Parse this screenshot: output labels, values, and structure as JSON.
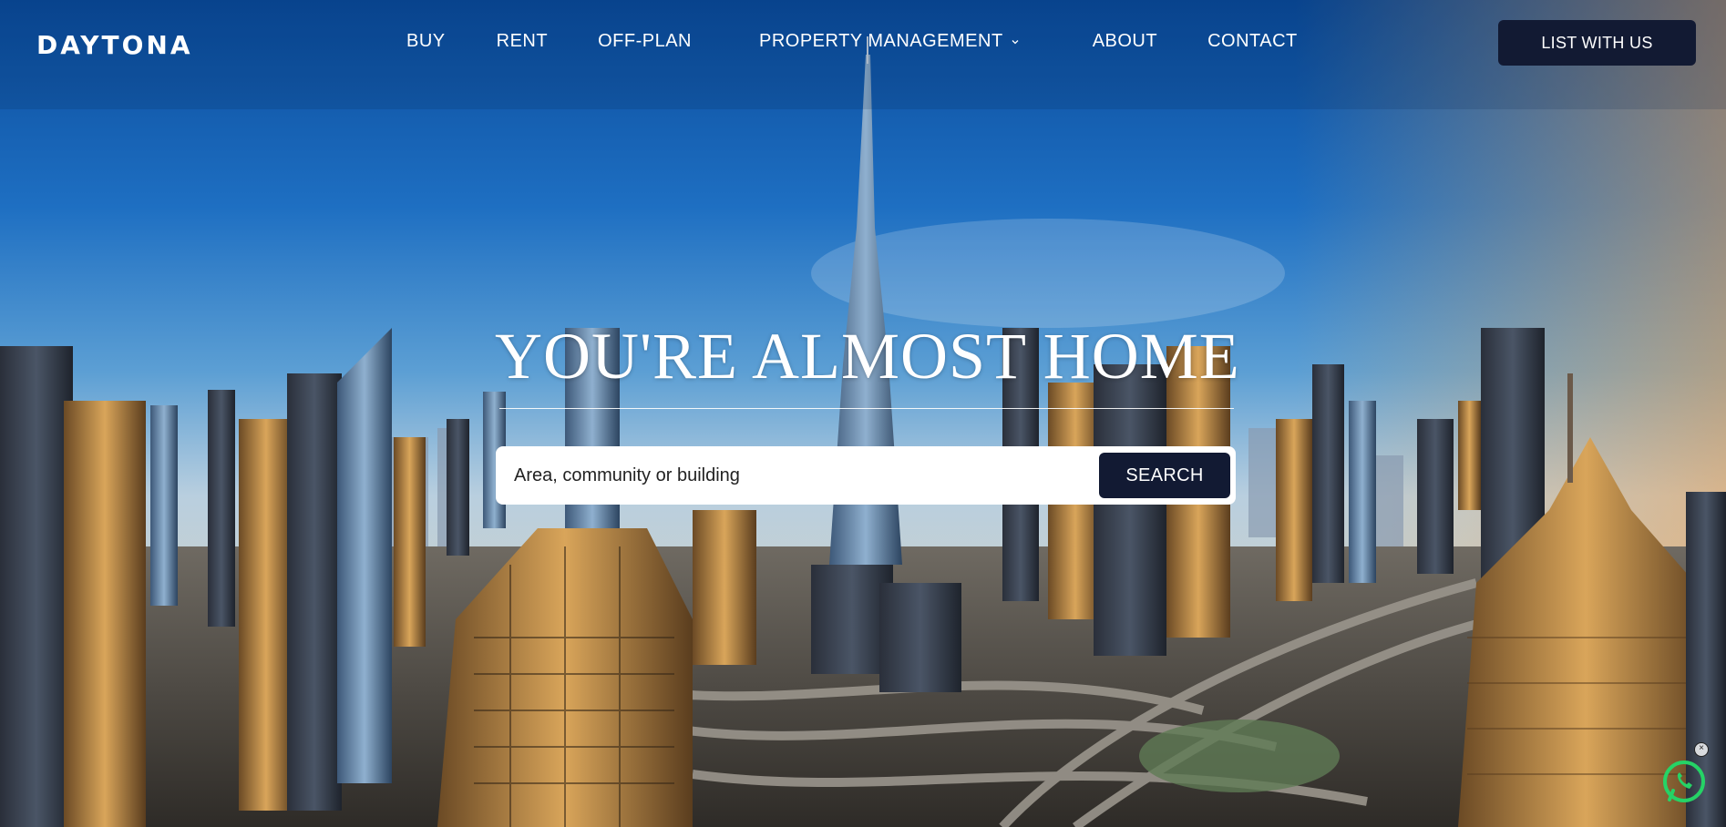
{
  "brand": {
    "logo_text": "DAYTONA"
  },
  "nav": {
    "items": [
      {
        "label": "BUY"
      },
      {
        "label": "RENT"
      },
      {
        "label": "OFF-PLAN"
      },
      {
        "label": "PROPERTY MANAGEMENT",
        "icon": "chevron-down-icon"
      },
      {
        "label": "ABOUT"
      },
      {
        "label": "CONTACT"
      }
    ],
    "cta_label": "LIST WITH US"
  },
  "hero": {
    "headline": "YOU'RE ALMOST HOME",
    "search": {
      "placeholder": "Area, community or building",
      "button_label": "SEARCH"
    }
  },
  "widgets": {
    "whatsapp_icon": "whatsapp-icon",
    "close_icon": "close-icon",
    "whatsapp_color": "#25d366"
  },
  "colors": {
    "button_bg": "#121a33",
    "text": "#ffffff"
  }
}
